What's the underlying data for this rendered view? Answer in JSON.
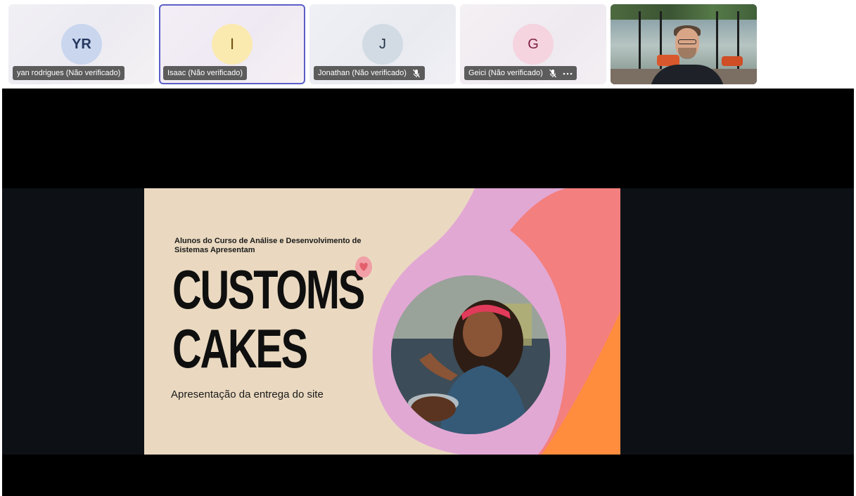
{
  "participants": [
    {
      "initials": "YR",
      "name": "yan rodrigues (Não verificado)",
      "muted": false,
      "more": false
    },
    {
      "initials": "I",
      "name": "Isaac (Não verificado)",
      "muted": false,
      "more": false,
      "speaking": true
    },
    {
      "initials": "J",
      "name": "Jonathan (Não verificado)",
      "muted": true,
      "more": false
    },
    {
      "initials": "G",
      "name": "Geici (Não verificado)",
      "muted": true,
      "more": true
    },
    {
      "video": true
    }
  ],
  "icons": {
    "muted": "mic-off-icon",
    "more": "more-options-icon"
  },
  "slide": {
    "subtitle": "Alunos do Curso de Análise e Desenvolvimento de Sistemas  Apresentam",
    "title_line1": "CUSTOMS",
    "title_line2": "CAKES",
    "tagline": "Apresentação da entrega do site"
  },
  "colors": {
    "active_speaker_border": "#5b5fc7",
    "slide_background": "#ead9c0",
    "slide_pink": "#e2a8d4",
    "slide_coral": "#f37f7e",
    "slide_orange": "#ff8d3d"
  }
}
